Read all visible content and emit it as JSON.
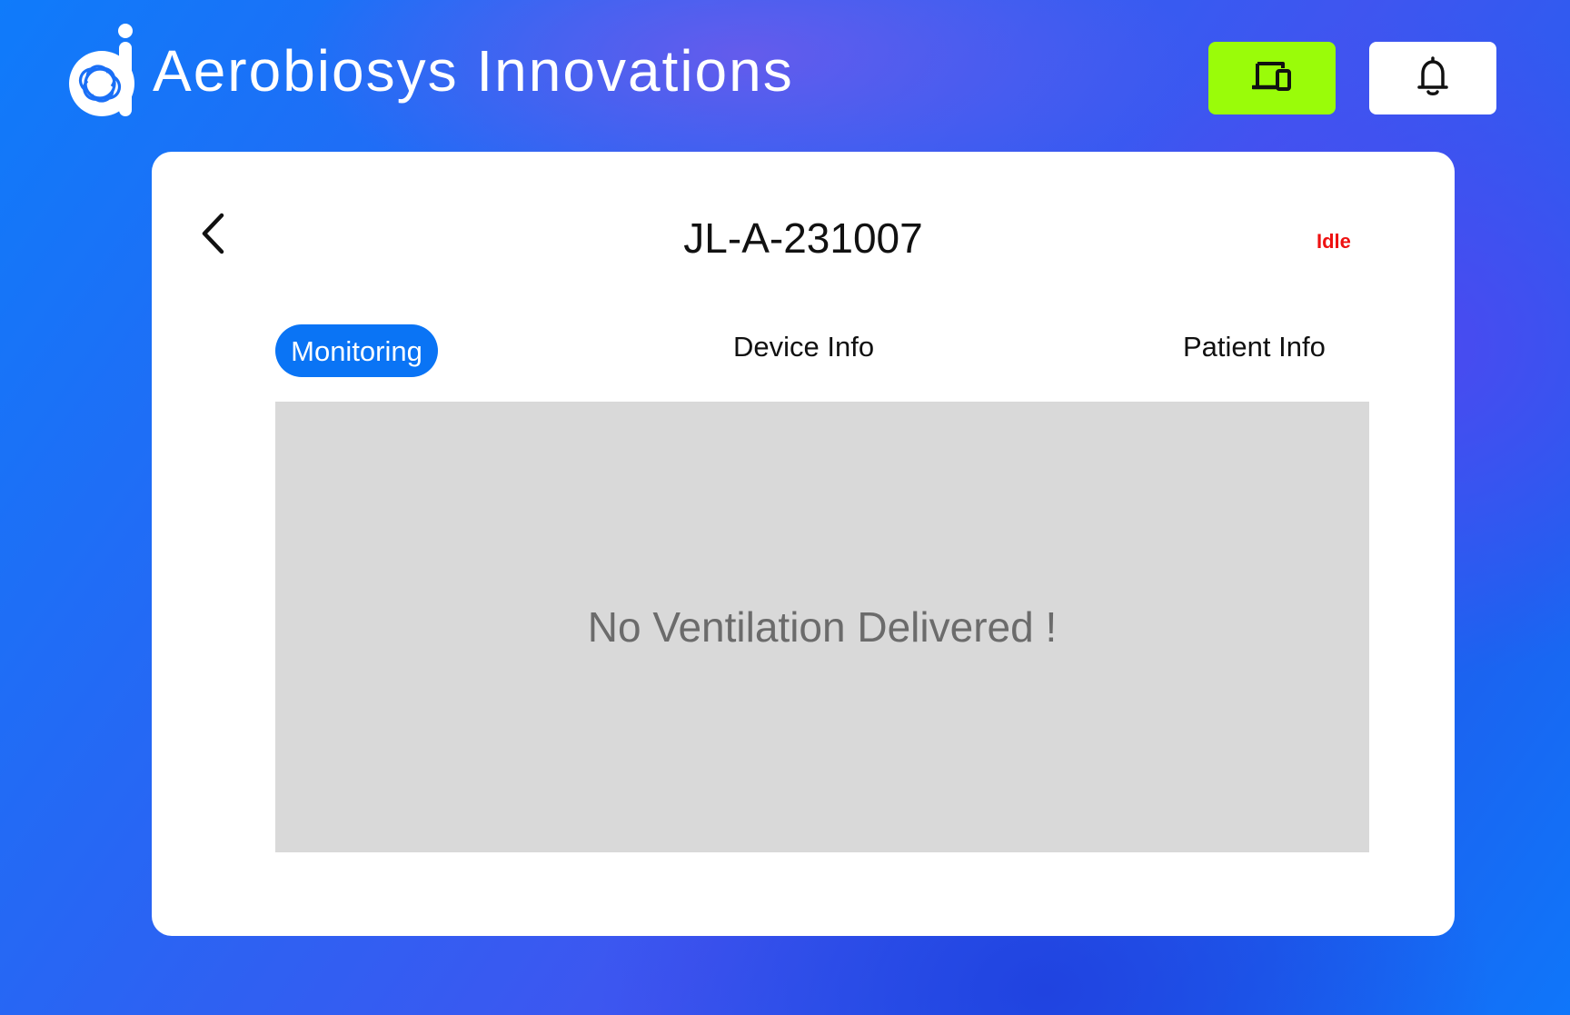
{
  "header": {
    "brand_name": "Aerobiosys Innovations",
    "logo_icon": "aerobiosys-logo",
    "buttons": [
      {
        "name": "devices",
        "icon": "devices-icon",
        "color": "#9afc09"
      },
      {
        "name": "notifications",
        "icon": "bell-icon",
        "color": "#ffffff"
      }
    ]
  },
  "device": {
    "id": "JL-A-231007",
    "status": "Idle",
    "status_color": "#ee1111"
  },
  "tabs": [
    {
      "label": "Monitoring",
      "active": true
    },
    {
      "label": "Device Info",
      "active": false
    },
    {
      "label": "Patient Info",
      "active": false
    }
  ],
  "monitoring_panel": {
    "message": "No Ventilation Delivered !"
  },
  "colors": {
    "accent": "#0a74f5",
    "devices_button": "#9afc09",
    "panel_background": "#d9d9d9"
  }
}
